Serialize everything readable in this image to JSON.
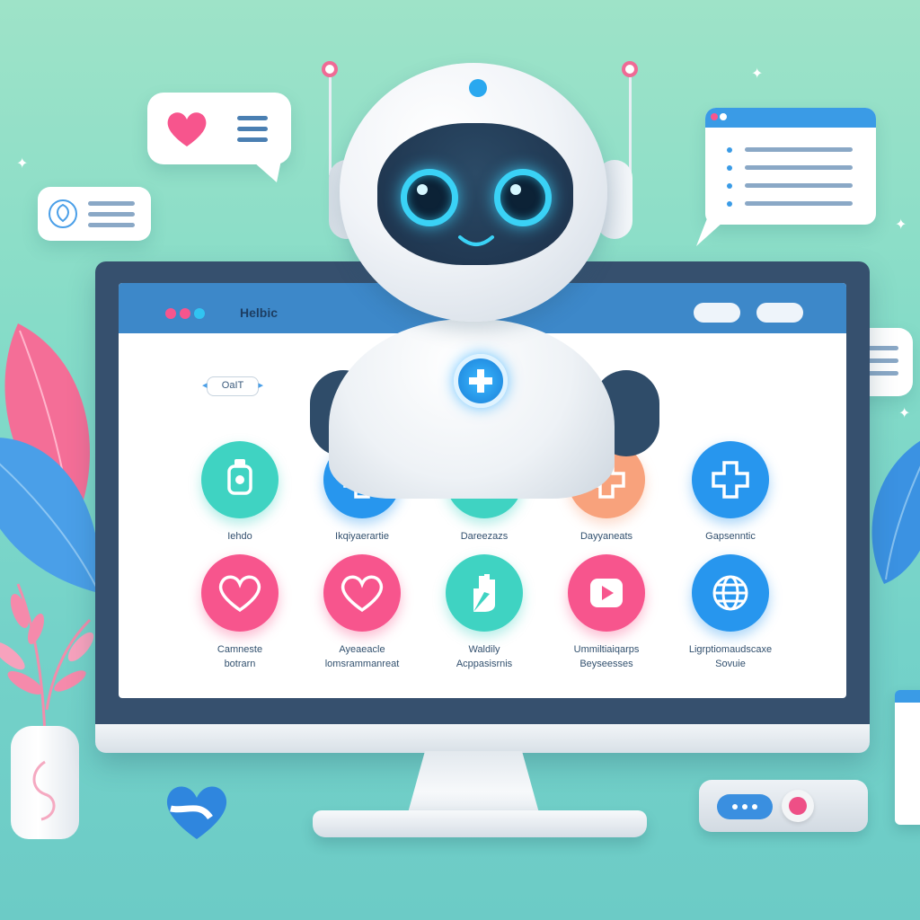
{
  "app": {
    "title": "Helbic",
    "window_buttons": [
      "",
      ""
    ],
    "selector_label": "OaIT"
  },
  "services": [
    {
      "label": "Iehdo",
      "icon": "watch-icon",
      "color": "#3fd3c2"
    },
    {
      "label": "Ikqiyaerartie",
      "icon": "medical-cross-icon",
      "color": "#2796ee"
    },
    {
      "label": "Dareezazs",
      "icon": "medical-cross-icon",
      "color": "#3fd3c2"
    },
    {
      "label": "Dayyaneats",
      "icon": "medical-cross-icon",
      "color": "#f8a27c"
    },
    {
      "label": "Gapsenntic",
      "icon": "medical-cross-icon",
      "color": "#2796ee"
    },
    {
      "label": "Camneste\nbotrarn",
      "icon": "heart-icon",
      "color": "#f7558d"
    },
    {
      "label": "Ayeaeacle\nlomsrammanreat",
      "icon": "heart-icon",
      "color": "#f7558d"
    },
    {
      "label": "Waldily\nAcppasisrnis",
      "icon": "hand-icon",
      "color": "#3fd3c2"
    },
    {
      "label": "Ummiltiaiqarps\nBeyseesses",
      "icon": "play-icon",
      "color": "#f7558d"
    },
    {
      "label": "Ligrptiomaudscaxe\nSovuie",
      "icon": "globe-icon",
      "color": "#2796ee"
    }
  ],
  "colors": {
    "accent": "#3d88c9",
    "teal": "#3fd3c2",
    "pink": "#f7558d",
    "orange": "#f8a27c",
    "blue": "#2796ee"
  }
}
